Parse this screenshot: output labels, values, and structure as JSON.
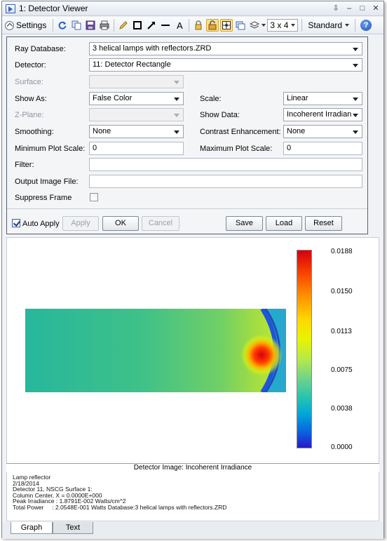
{
  "window": {
    "title": "1: Detector Viewer",
    "controls": [
      "⇩",
      "–",
      "□",
      "✕"
    ]
  },
  "toolbar": {
    "settings_label": "Settings",
    "layout_value": "3 x 4",
    "style_value": "Standard",
    "help_label": "?",
    "text_tool_label": "A"
  },
  "form": {
    "ray_database_label": "Ray Database:",
    "ray_database_value": "3 helical lamps with reflectors.ZRD",
    "detector_label": "Detector:",
    "detector_value": "11: Detector Rectangle",
    "surface_label": "Surface:",
    "surface_value": "",
    "show_as_label": "Show As:",
    "show_as_value": "False Color",
    "scale_label": "Scale:",
    "scale_value": "Linear",
    "z_plane_label": "Z-Plane:",
    "z_plane_value": "",
    "show_data_label": "Show Data:",
    "show_data_value": "Incoherent Irradian",
    "smoothing_label": "Smoothing:",
    "smoothing_value": "None",
    "contrast_label": "Contrast Enhancement:",
    "contrast_value": "None",
    "min_plot_scale_label": "Minimum Plot Scale:",
    "min_plot_scale_value": "0",
    "max_plot_scale_label": "Maximum Plot Scale:",
    "max_plot_scale_value": "0",
    "filter_label": "Filter:",
    "filter_value": "",
    "output_image_label": "Output Image File:",
    "output_image_value": "",
    "suppress_frame_label": "Suppress Frame",
    "suppress_frame_checked": false,
    "auto_apply_label": "Auto Apply",
    "auto_apply_checked": true
  },
  "buttons": {
    "apply": "Apply",
    "ok": "OK",
    "cancel": "Cancel",
    "save": "Save",
    "load": "Load",
    "reset": "Reset"
  },
  "graph": {
    "colorbar_labels": [
      "0.0188",
      "0.0150",
      "0.0113",
      "0.0075",
      "0.0038",
      "0.0000"
    ],
    "caption": "Detector Image: Incoherent Irradiance"
  },
  "info": {
    "lines": [
      "Lamp reflector",
      "2/18/2014",
      "Detector 11, NSCG Surface 1:",
      "Column Center, X = 0.0000E+000",
      "Peak Irradiance : 1.8791E-002 Watts/cm^2",
      "Total Power     : 2.0548E-001 Watts Database:3 helical lamps with reflectors.ZRD"
    ]
  },
  "tabs": {
    "graph": "Graph",
    "text": "Text"
  },
  "colors": {
    "accent_active": "#fbdf8b",
    "peak": "#d4000f",
    "background_field": "#2ab9a8"
  }
}
